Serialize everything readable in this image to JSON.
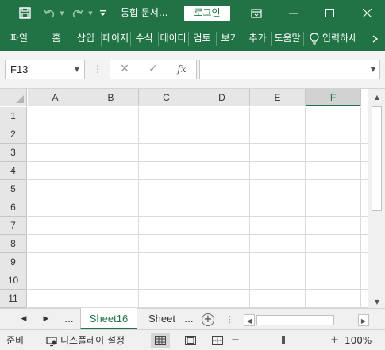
{
  "colors": {
    "accent": "#217346",
    "grid": "#dadada",
    "header_bg": "#e6e6e6"
  },
  "titlebar": {
    "title": "통합 문서...",
    "login_label": "로그인",
    "icons": [
      "save-icon",
      "undo-icon",
      "redo-icon",
      "customize-qat-icon",
      "ribbon-display-icon",
      "minimize-icon",
      "maximize-icon",
      "close-icon"
    ]
  },
  "ribbon": {
    "tabs": [
      "파일",
      "홈",
      "삽입",
      "페이지",
      "수식",
      "데이터",
      "검토",
      "보기",
      "추가",
      "도움말"
    ],
    "tell_me": "입력하세"
  },
  "formula_bar": {
    "name_box": "F13",
    "fx_label": "fx",
    "formula_value": ""
  },
  "grid": {
    "columns": [
      "A",
      "B",
      "C",
      "D",
      "E",
      "F"
    ],
    "selected_column": "F",
    "rows": [
      "1",
      "2",
      "3",
      "4",
      "5",
      "6",
      "7",
      "8",
      "9",
      "10",
      "11"
    ]
  },
  "sheets": {
    "active": "Sheet16",
    "other": "Sheet",
    "more": "...",
    "add_label": "+"
  },
  "status": {
    "ready": "준비",
    "display_settings": "디스플레이 설정",
    "zoom": "100%",
    "zoom_minus": "−",
    "zoom_plus": "+"
  }
}
